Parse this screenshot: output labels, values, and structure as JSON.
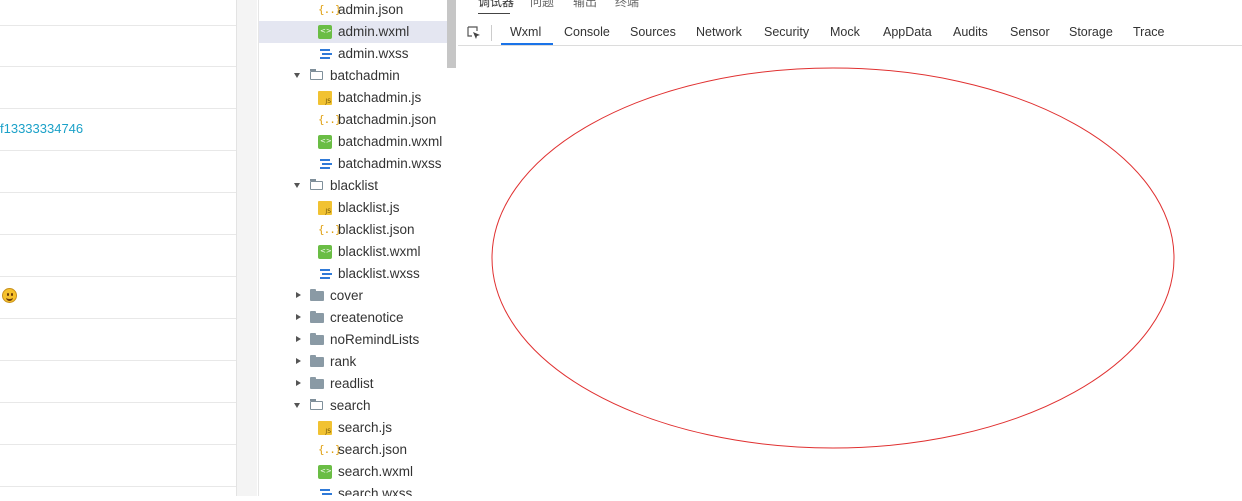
{
  "left_panel": {
    "rows": [
      {
        "text": ""
      },
      {
        "text": ""
      },
      {
        "text": "f13333334746"
      },
      {
        "text": ""
      },
      {
        "text": ""
      },
      {
        "text": ""
      },
      {
        "emoji": "smiley-emoji"
      },
      {
        "text": ""
      },
      {
        "text": ""
      },
      {
        "text": ""
      },
      {
        "text": ""
      }
    ]
  },
  "file_tree": {
    "items": [
      {
        "name": "admin.json",
        "icon": "json-file-icon",
        "level": 2
      },
      {
        "name": "admin.wxml",
        "icon": "wxml-file-icon",
        "level": 2,
        "selected": true
      },
      {
        "name": "admin.wxss",
        "icon": "wxss-file-icon",
        "level": 2
      },
      {
        "name": "batchadmin",
        "icon": "folder-open-icon",
        "level": 1,
        "expanded": true
      },
      {
        "name": "batchadmin.js",
        "icon": "js-file-icon",
        "level": 2
      },
      {
        "name": "batchadmin.json",
        "icon": "json-file-icon",
        "level": 2
      },
      {
        "name": "batchadmin.wxml",
        "icon": "wxml-file-icon",
        "level": 2
      },
      {
        "name": "batchadmin.wxss",
        "icon": "wxss-file-icon",
        "level": 2
      },
      {
        "name": "blacklist",
        "icon": "folder-open-icon",
        "level": 1,
        "expanded": true
      },
      {
        "name": "blacklist.js",
        "icon": "js-file-icon",
        "level": 2
      },
      {
        "name": "blacklist.json",
        "icon": "json-file-icon",
        "level": 2
      },
      {
        "name": "blacklist.wxml",
        "icon": "wxml-file-icon",
        "level": 2
      },
      {
        "name": "blacklist.wxss",
        "icon": "wxss-file-icon",
        "level": 2
      },
      {
        "name": "cover",
        "icon": "folder-closed-icon",
        "level": 1,
        "expanded": false
      },
      {
        "name": "createnotice",
        "icon": "folder-closed-icon",
        "level": 1,
        "expanded": false
      },
      {
        "name": "noRemindLists",
        "icon": "folder-closed-icon",
        "level": 1,
        "expanded": false
      },
      {
        "name": "rank",
        "icon": "folder-closed-icon",
        "level": 1,
        "expanded": false
      },
      {
        "name": "readlist",
        "icon": "folder-closed-icon",
        "level": 1,
        "expanded": false
      },
      {
        "name": "search",
        "icon": "folder-open-icon",
        "level": 1,
        "expanded": true
      },
      {
        "name": "search.js",
        "icon": "js-file-icon",
        "level": 2
      },
      {
        "name": "search.json",
        "icon": "json-file-icon",
        "level": 2
      },
      {
        "name": "search.wxml",
        "icon": "wxml-file-icon",
        "level": 2
      },
      {
        "name": "search.wxss",
        "icon": "wxss-file-icon",
        "level": 2
      }
    ]
  },
  "devtools": {
    "top_tabs": [
      {
        "label": "调试器",
        "active": true
      },
      {
        "label": "问题"
      },
      {
        "label": "输出"
      },
      {
        "label": "终端"
      }
    ],
    "panel_tabs": [
      {
        "label": "Wxml",
        "active": true
      },
      {
        "label": "Console"
      },
      {
        "label": "Sources"
      },
      {
        "label": "Network"
      },
      {
        "label": "Security"
      },
      {
        "label": "Mock"
      },
      {
        "label": "AppData"
      },
      {
        "label": "Audits"
      },
      {
        "label": "Sensor"
      },
      {
        "label": "Storage"
      },
      {
        "label": "Trace"
      }
    ],
    "annotation": {
      "shape": "ellipse",
      "color": "#e03030"
    }
  },
  "colors": {
    "link": "#1ba1c8",
    "selected_row": "#e4e6f1",
    "active_tab_underline": "#1a73e8"
  }
}
